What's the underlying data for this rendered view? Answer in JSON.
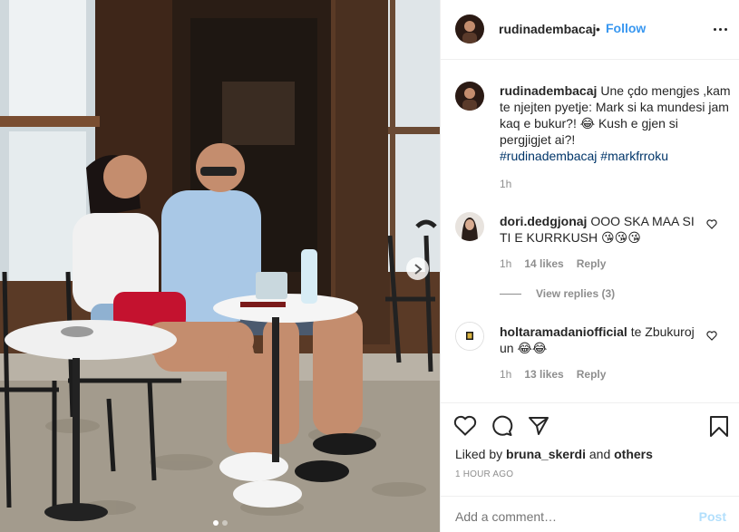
{
  "post": {
    "username": "rudinadembacaj",
    "separator": "•",
    "follow_label": "Follow",
    "photo_alt": "Couple sitting at cafe table outdoors",
    "carousel_dots": 2
  },
  "caption": {
    "username": "rudinadembacaj",
    "text": "Une çdo mengjes ,kam te njejten pyetje: Mark si ka mundesi jam kaq e bukur?! 😂 Kush e gjen si pergjigjet ai?!",
    "hashtags": "#rudinadembacaj #markfrroku",
    "time": "1h"
  },
  "comments": [
    {
      "username": "dori.dedgjonaj",
      "text": "OOO SKA MAA SI TI E KURRKUSH 😘😘😘",
      "time": "1h",
      "likes": "14 likes",
      "reply_label": "Reply",
      "view_replies": "View replies (3)"
    },
    {
      "username": "holtaramadaniofficial",
      "text": "te Zbukuroj un 😂😂",
      "time": "1h",
      "likes": "13 likes",
      "reply_label": "Reply"
    }
  ],
  "likes": {
    "prefix": "Liked by",
    "user": "bruna_skerdi",
    "and": "and",
    "others": "others"
  },
  "timestamp": "1 HOUR AGO",
  "add_comment": {
    "placeholder": "Add a comment…",
    "post_label": "Post"
  },
  "colors": {
    "accent": "#3897f0",
    "hashtag": "#003569",
    "muted": "#8e8e8e",
    "post_disabled": "#b2dffc"
  }
}
